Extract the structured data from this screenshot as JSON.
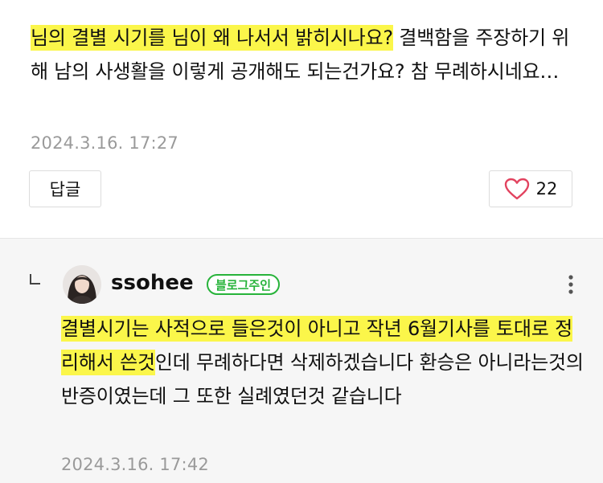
{
  "comment": {
    "text_highlight": "님의 결별 시기를 님이 왜 나서서 밝히시나요?",
    "text_rest": " 결백함을 주장하기 위해 남의 사생활을 이렇게 공개해도 되는건가요? 참 무례하시네요…",
    "date": "2024.3.16.  17:27",
    "reply_label": "답글",
    "like_count": "22",
    "heart_color": "#e2435f"
  },
  "reply": {
    "username": "ssohee",
    "badge": "블로그주인",
    "badge_color": "#27b33a",
    "text_highlight": "결별시기는 사적으로 들은것이 아니고 작년 6월기사를 토대로 정리해서 쓴것",
    "text_rest": "인데 무례하다면 삭제하겠습니다 환승은 아니라는것의 반증이였는데 그 또한 실례였던것 같습니다",
    "date": "2024.3.16.  17:42"
  },
  "highlight_color": "#fbf64a"
}
